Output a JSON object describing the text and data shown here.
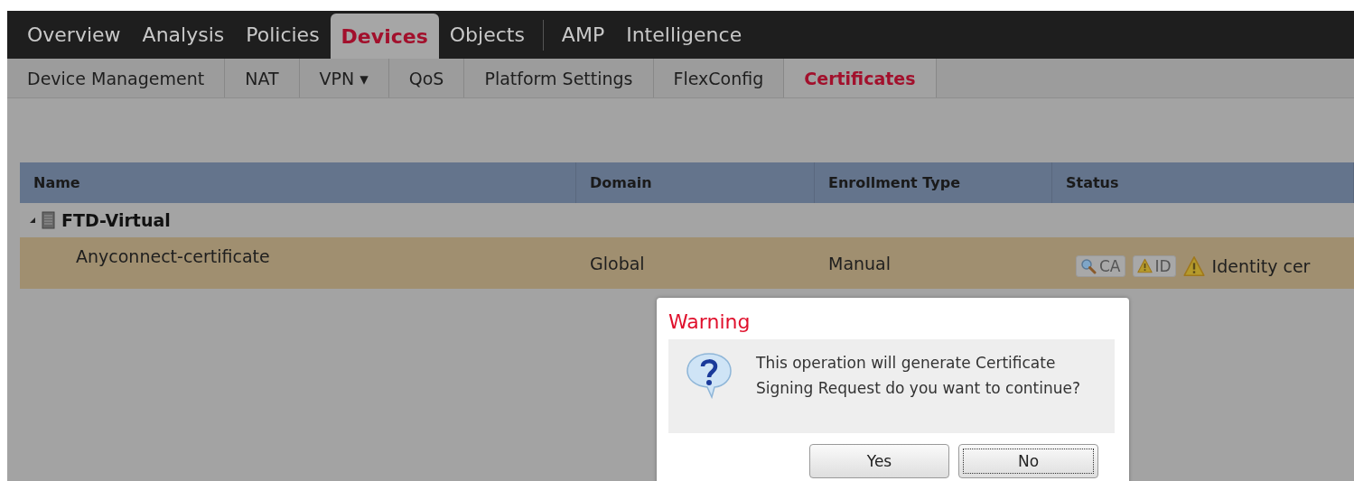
{
  "main_nav": [
    {
      "label": "Overview",
      "selected": false,
      "separator_before": false
    },
    {
      "label": "Analysis",
      "selected": false,
      "separator_before": false
    },
    {
      "label": "Policies",
      "selected": false,
      "separator_before": false
    },
    {
      "label": "Devices",
      "selected": true,
      "separator_before": false
    },
    {
      "label": "Objects",
      "selected": false,
      "separator_before": false
    },
    {
      "label": "AMP",
      "selected": false,
      "separator_before": true
    },
    {
      "label": "Intelligence",
      "selected": false,
      "separator_before": false
    }
  ],
  "sub_nav": [
    {
      "label": "Device Management",
      "selected": false
    },
    {
      "label": "NAT",
      "selected": false
    },
    {
      "label": "VPN ▾",
      "selected": false
    },
    {
      "label": "QoS",
      "selected": false
    },
    {
      "label": "Platform Settings",
      "selected": false
    },
    {
      "label": "FlexConfig",
      "selected": false
    },
    {
      "label": "Certificates",
      "selected": true
    }
  ],
  "table": {
    "columns": [
      "Name",
      "Domain",
      "Enrollment Type",
      "Status"
    ],
    "groups": [
      {
        "name": "FTD-Virtual",
        "expanded": true,
        "rows": [
          {
            "name": "Anyconnect-certificate",
            "domain": "Global",
            "enrollment_type": "Manual",
            "selected": true,
            "status": {
              "badges": [
                {
                  "kind": "ca",
                  "label": "CA"
                },
                {
                  "kind": "id",
                  "label": "ID"
                }
              ],
              "text": "Identity cer"
            }
          }
        ]
      }
    ]
  },
  "dialog": {
    "title": "Warning",
    "message": "This operation will generate Certificate Signing Request do you want to continue?",
    "buttons": [
      {
        "label": "Yes",
        "focused": false
      },
      {
        "label": "No",
        "focused": true
      }
    ]
  }
}
